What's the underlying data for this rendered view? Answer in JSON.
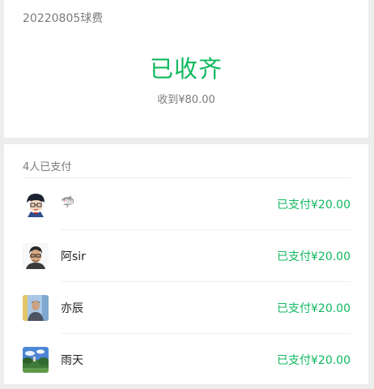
{
  "header": {
    "subject": "20220805球费",
    "status": "已收齐",
    "received": "收到¥80.00"
  },
  "payments": {
    "summary": "4人已支付",
    "items": [
      {
        "name": "🦈",
        "amount": "已支付¥20.00",
        "avatar": "cartoon-avatar"
      },
      {
        "name": "阿sir",
        "amount": "已支付¥20.00",
        "avatar": "portrait-avatar"
      },
      {
        "name": "亦辰",
        "amount": "已支付¥20.00",
        "avatar": "photo-avatar"
      },
      {
        "name": "雨天",
        "amount": "已支付¥20.00",
        "avatar": "landscape-avatar"
      }
    ]
  },
  "colors": {
    "accent": "#10b85e",
    "muted": "#7b7b7b",
    "background": "#ededed"
  }
}
